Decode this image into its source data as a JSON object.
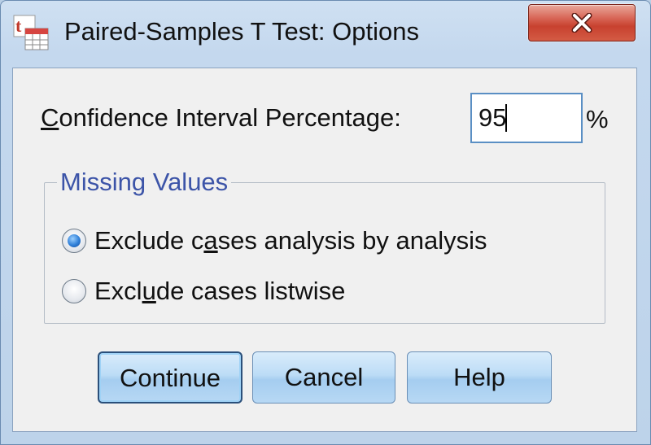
{
  "window": {
    "title": "Paired-Samples T Test: Options",
    "app_icon": "spss-ttest-icon",
    "close_icon": "close-icon"
  },
  "confidence": {
    "label_underlined": "C",
    "label_rest": "onfidence Interval Percentage:",
    "value": "95",
    "unit": "%"
  },
  "missing_values": {
    "legend": "Missing Values",
    "options": [
      {
        "pre": "Exclude c",
        "ul": "a",
        "post": "ses analysis by analysis",
        "checked": true
      },
      {
        "pre": "Excl",
        "ul": "u",
        "post": "de cases listwise",
        "checked": false
      }
    ]
  },
  "buttons": {
    "continue": "Continue",
    "cancel": "Cancel",
    "help": "Help"
  },
  "colors": {
    "legend_text": "#3c54a8",
    "close_button": "#c8412f",
    "button_face": "#bcdcf6"
  }
}
